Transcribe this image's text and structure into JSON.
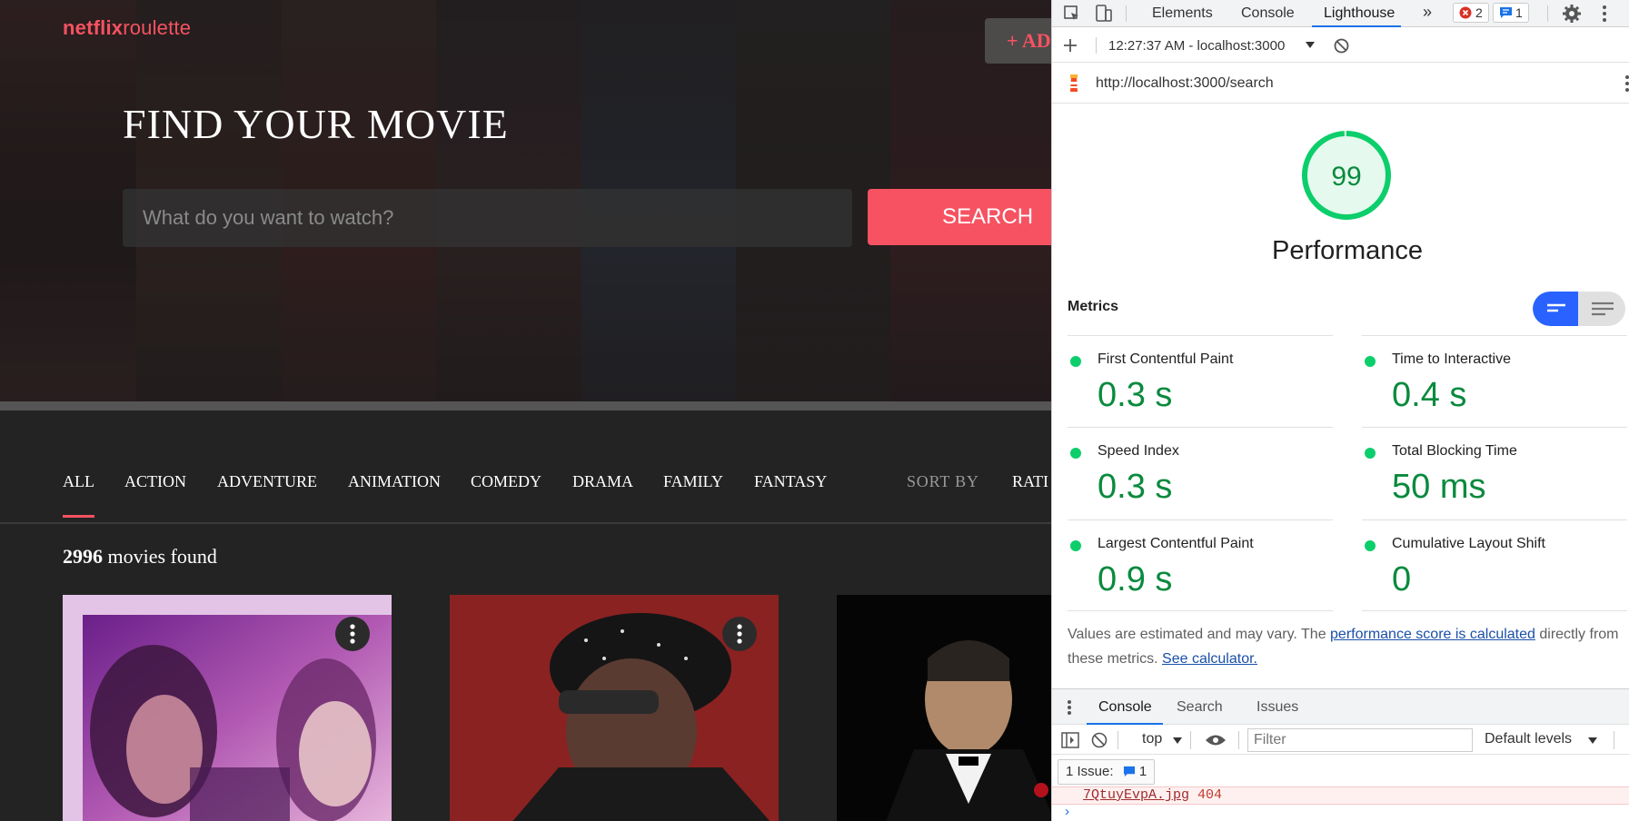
{
  "app": {
    "logo_bold": "netflix",
    "logo_light": "roulette",
    "add_movie_label": "+ ADD",
    "hero_title": "FIND YOUR MOVIE",
    "search_placeholder": "What do you want to watch?",
    "search_button": "SEARCH",
    "genres": [
      "ALL",
      "ACTION",
      "ADVENTURE",
      "ANIMATION",
      "COMEDY",
      "DRAMA",
      "FAMILY",
      "FANTASY"
    ],
    "active_genre": "ALL",
    "sort_label": "SORT BY",
    "sort_value": "RATI",
    "results_count": "2996",
    "results_suffix": " movies found",
    "brand_color": "#f65261"
  },
  "devtools": {
    "tabs": [
      "Elements",
      "Console",
      "Lighthouse"
    ],
    "active_tab": "Lighthouse",
    "more_tabs_icon": "»",
    "error_badge_count": "2",
    "message_badge_count": "1",
    "report_selector": "12:27:37 AM - localhost:3000",
    "report_url": "http://localhost:3000/search",
    "score": "99",
    "score_value": 99,
    "category_title": "Performance",
    "metrics_heading": "Metrics",
    "metrics": [
      {
        "label": "First Contentful Paint",
        "value": "0.3 s"
      },
      {
        "label": "Time to Interactive",
        "value": "0.4 s"
      },
      {
        "label": "Speed Index",
        "value": "0.3 s"
      },
      {
        "label": "Total Blocking Time",
        "value": "50 ms"
      },
      {
        "label": "Largest Contentful Paint",
        "value": "0.9 s"
      },
      {
        "label": "Cumulative Layout Shift",
        "value": "0"
      }
    ],
    "footnote_prefix": "Values are estimated and may vary. The ",
    "footnote_link": "performance score is calculated",
    "footnote_middle": " directly from these metrics. ",
    "footnote_calc_link": "See calculator.",
    "drawer_tabs": [
      "Console",
      "Search",
      "Issues"
    ],
    "drawer_active_tab": "Console",
    "context_select": "top",
    "filter_placeholder": "Filter",
    "levels_select": "Default levels",
    "issues_label": "1 Issue:",
    "issues_count": "1",
    "console_error_file": "7QtuyEvpA.jpg",
    "console_error_code": "404",
    "console_prompt": "›",
    "pass_color": "#0cce6b"
  }
}
